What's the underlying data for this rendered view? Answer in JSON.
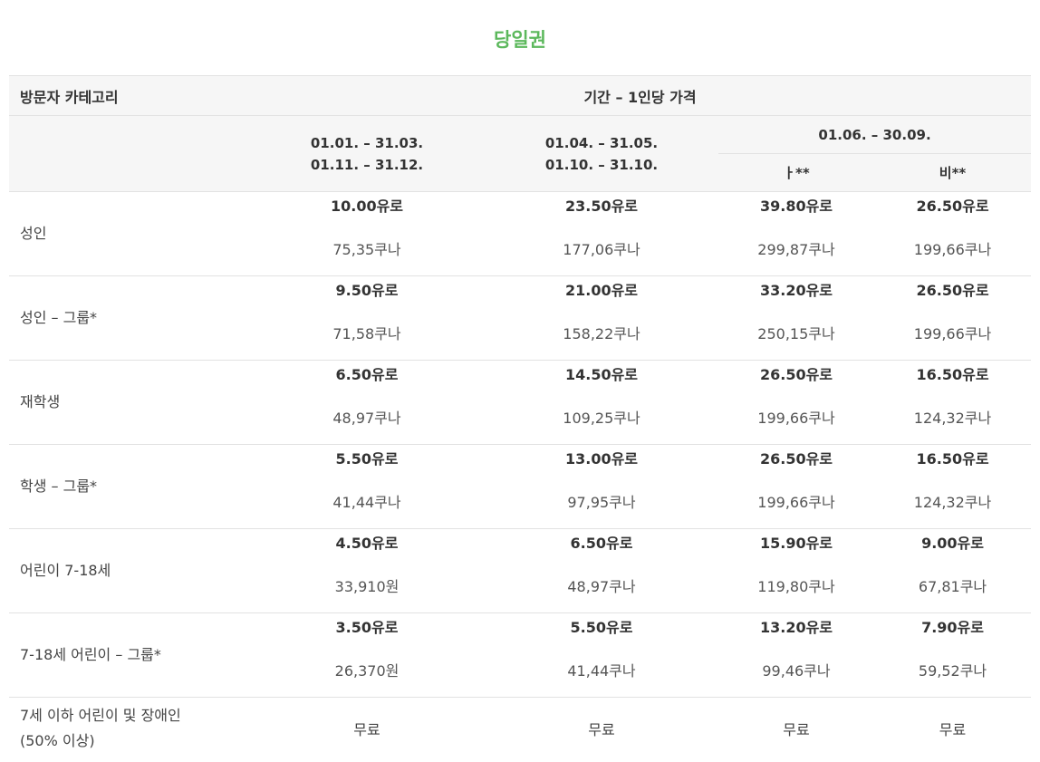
{
  "title": "당일권",
  "header": {
    "category": "방문자 카테고리",
    "period": "기간 – 1인당 가격",
    "col1_line1": "01.01. – 31.03.",
    "col1_line2": "01.11. – 31.12.",
    "col2_line1": "01.04. – 31.05.",
    "col2_line2": "01.10. – 31.10.",
    "col3_range": "01.06. – 30.09.",
    "col3_sub1": "ㅏ**",
    "col3_sub2": "비**"
  },
  "rows": [
    {
      "category": "성인",
      "prices": [
        {
          "eur": "10.00유로",
          "local": "75,35쿠나"
        },
        {
          "eur": "23.50유로",
          "local": "177,06쿠나"
        },
        {
          "eur": "39.80유로",
          "local": "299,87쿠나"
        },
        {
          "eur": "26.50유로",
          "local": "199,66쿠나"
        }
      ]
    },
    {
      "category": "성인 – 그룹*",
      "prices": [
        {
          "eur": "9.50유로",
          "local": "71,58쿠나"
        },
        {
          "eur": "21.00유로",
          "local": "158,22쿠나"
        },
        {
          "eur": "33.20유로",
          "local": "250,15쿠나"
        },
        {
          "eur": "26.50유로",
          "local": "199,66쿠나"
        }
      ]
    },
    {
      "category": "재학생",
      "prices": [
        {
          "eur": "6.50유로",
          "local": "48,97쿠나"
        },
        {
          "eur": "14.50유로",
          "local": "109,25쿠나"
        },
        {
          "eur": "26.50유로",
          "local": "199,66쿠나"
        },
        {
          "eur": "16.50유로",
          "local": "124,32쿠나"
        }
      ]
    },
    {
      "category": "학생 – 그룹*",
      "prices": [
        {
          "eur": "5.50유로",
          "local": "41,44쿠나"
        },
        {
          "eur": "13.00유로",
          "local": "97,95쿠나"
        },
        {
          "eur": "26.50유로",
          "local": "199,66쿠나"
        },
        {
          "eur": "16.50유로",
          "local": "124,32쿠나"
        }
      ]
    },
    {
      "category": "어린이 7-18세",
      "prices": [
        {
          "eur": "4.50유로",
          "local": "33,910원"
        },
        {
          "eur": "6.50유로",
          "local": "48,97쿠나"
        },
        {
          "eur": "15.90유로",
          "local": "119,80쿠나"
        },
        {
          "eur": "9.00유로",
          "local": "67,81쿠나"
        }
      ]
    },
    {
      "category": "7-18세 어린이 – 그룹*",
      "prices": [
        {
          "eur": "3.50유로",
          "local": "26,370원"
        },
        {
          "eur": "5.50유로",
          "local": "41,44쿠나"
        },
        {
          "eur": "13.20유로",
          "local": "99,46쿠나"
        },
        {
          "eur": "7.90유로",
          "local": "59,52쿠나"
        }
      ]
    }
  ],
  "last_row": {
    "category_line1": "7세 이하 어린이 및 장애인",
    "category_line2": "(50% 이상)",
    "free": [
      "무료",
      "무료",
      "무료",
      "무료"
    ]
  }
}
